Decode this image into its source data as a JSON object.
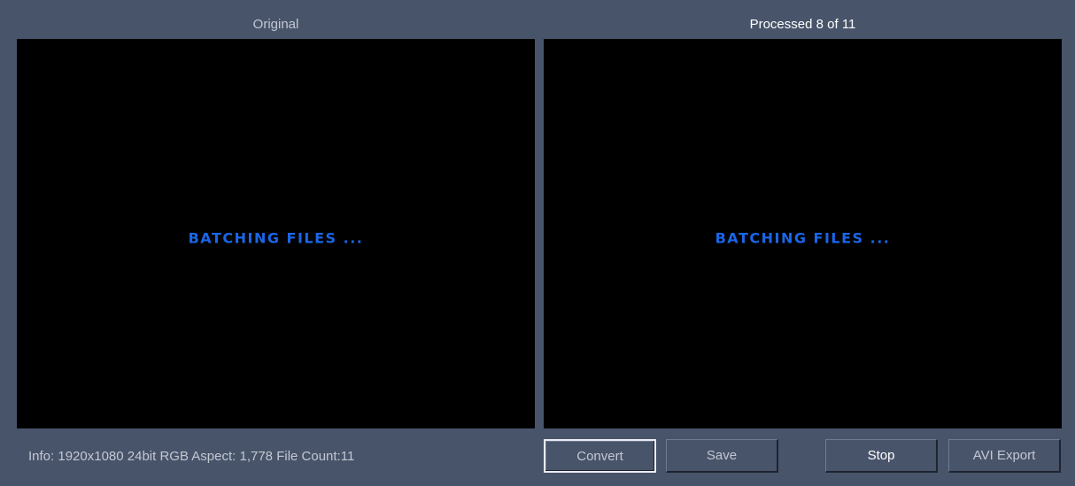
{
  "original_panel": {
    "title": "Original",
    "status": "BATCHING FILES ..."
  },
  "processed_panel": {
    "title": "Processed 8 of 11",
    "status": "BATCHING FILES ..."
  },
  "info": {
    "text": "Info:  1920x1080 24bit RGB Aspect: 1,778 File Count:11"
  },
  "buttons": {
    "convert": "Convert",
    "save": "Save",
    "stop": "Stop",
    "avi_export": "AVI Export"
  },
  "colors": {
    "background": "#48546a",
    "viewport": "#000000",
    "status_text": "#1a66e8"
  }
}
